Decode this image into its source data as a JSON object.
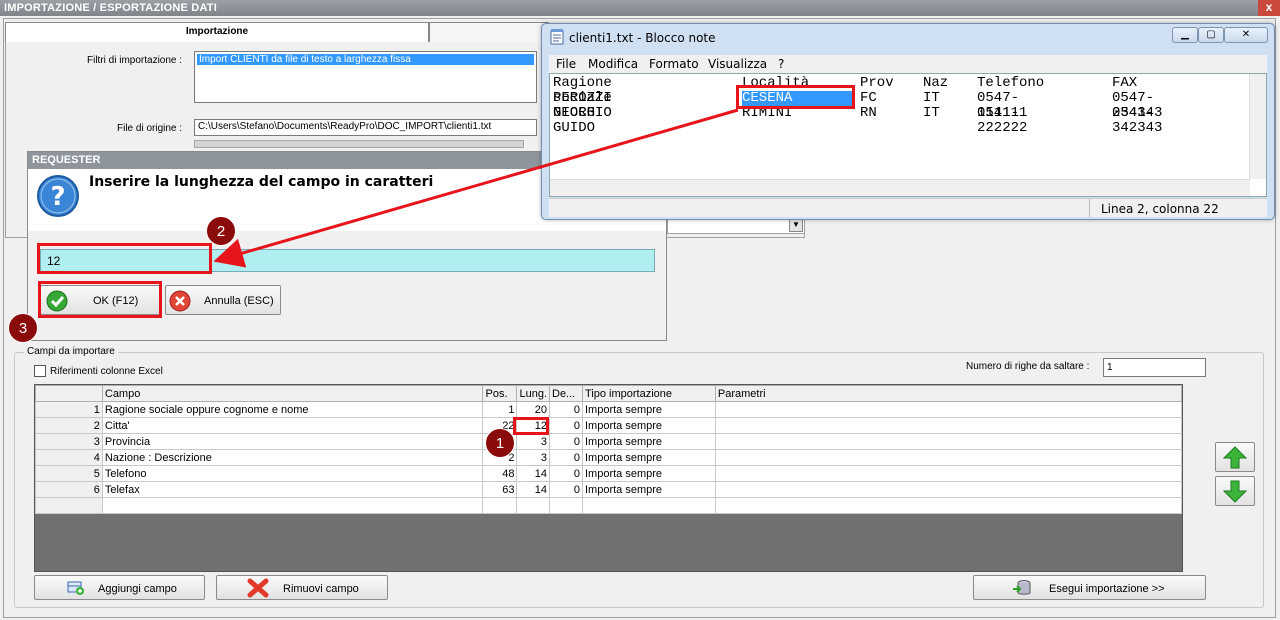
{
  "app": {
    "title": "IMPORTAZIONE / ESPORTAZIONE DATI",
    "close_glyph": "x"
  },
  "tabs": [
    {
      "label": "Importazione"
    },
    {
      "label": ""
    }
  ],
  "form": {
    "filtri_label": "Filtri di importazione :",
    "filtri_value": "Import CLIENTI da file di testo a larghezza fissa",
    "file_label": "File di origine :",
    "file_value": "C:\\Users\\Stefano\\Documents\\ReadyPro\\DOC_IMPORT\\clienti1.txt"
  },
  "fields_group": {
    "label": "Campi da importare",
    "excel_label": "Riferimenti colonne Excel",
    "excel_checked": false,
    "skip_label": "Numero di righe da saltare :",
    "skip_value": "1"
  },
  "grid": {
    "headers": [
      "",
      "Campo",
      "Pos.",
      "Lung.",
      "De...",
      "Tipo importazione",
      "Parametri"
    ],
    "rows": [
      {
        "n": "1",
        "campo": "Ragione sociale oppure cognome e nome",
        "pos": "1",
        "lung": "20",
        "dec": "0",
        "tipo": "Importa sempre",
        "param": ""
      },
      {
        "n": "2",
        "campo": "Citta'",
        "pos": "22",
        "lung": "12",
        "dec": "0",
        "tipo": "Importa sempre",
        "param": ""
      },
      {
        "n": "3",
        "campo": "Provincia",
        "pos": "",
        "lung": "3",
        "dec": "0",
        "tipo": "Importa sempre",
        "param": ""
      },
      {
        "n": "4",
        "campo": "Nazione : Descrizione",
        "pos": "2",
        "lung": "3",
        "dec": "0",
        "tipo": "Importa sempre",
        "param": ""
      },
      {
        "n": "5",
        "campo": "Telefono",
        "pos": "48",
        "lung": "14",
        "dec": "0",
        "tipo": "Importa sempre",
        "param": ""
      },
      {
        "n": "6",
        "campo": "Telefax",
        "pos": "63",
        "lung": "14",
        "dec": "0",
        "tipo": "Importa sempre",
        "param": ""
      }
    ]
  },
  "buttons": {
    "add": "Aggiungi campo",
    "remove": "Rimuovi campo",
    "run": "Esegui importazione >>"
  },
  "requester": {
    "title": "REQUESTER",
    "question": "Inserire la lunghezza del campo in caratteri",
    "input_value": "12",
    "ok_label": "OK (F12)",
    "cancel_label": "Annulla (ESC)"
  },
  "notepad": {
    "title": "clienti1.txt - Blocco note",
    "menu": [
      "File",
      "Modifica",
      "Formato",
      "Visualizza",
      "?"
    ],
    "lines": [
      {
        "ragione": "Ragione sociale",
        "localita": "Località",
        "prov": "Prov",
        "naz": "Naz",
        "tel": "Telefono",
        "fax": "FAX"
      },
      {
        "ragione": "PEROZZI GIORGIO",
        "localita": "CESENA",
        "prov": "FC",
        "naz": "IT",
        "tel": "0547-111111",
        "fax": "0547-234343"
      },
      {
        "ragione": "NECCHI GUIDO",
        "localita": "RIMINI",
        "prov": "RN",
        "naz": "IT",
        "tel": "0541-222222",
        "fax": "0541-342343"
      }
    ],
    "status": "Linea 2, colonna 22"
  },
  "markers": [
    "1",
    "2",
    "3"
  ],
  "colors": {
    "highlight_red": "#e8141c",
    "marker": "#8b0a0a",
    "input_bg": "#b0eef0",
    "selection": "#3399ff"
  }
}
